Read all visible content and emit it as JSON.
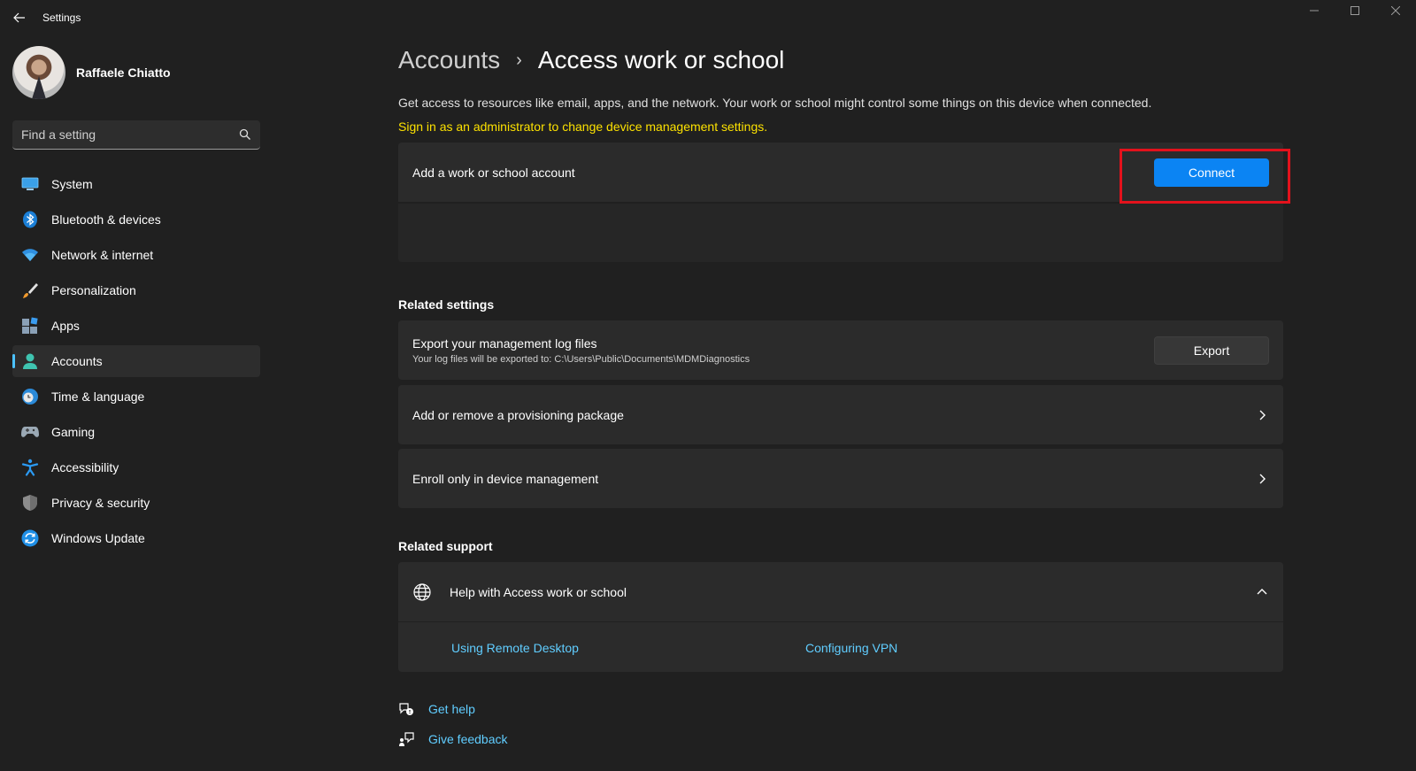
{
  "window": {
    "title": "Settings"
  },
  "profile": {
    "name": "Raffaele Chiatto"
  },
  "search": {
    "placeholder": "Find a setting"
  },
  "sidebar": {
    "items": [
      {
        "label": "System",
        "icon": "monitor-icon"
      },
      {
        "label": "Bluetooth & devices",
        "icon": "bluetooth-icon"
      },
      {
        "label": "Network & internet",
        "icon": "wifi-icon"
      },
      {
        "label": "Personalization",
        "icon": "brush-icon"
      },
      {
        "label": "Apps",
        "icon": "apps-icon"
      },
      {
        "label": "Accounts",
        "icon": "person-icon",
        "active": true
      },
      {
        "label": "Time & language",
        "icon": "globe-clock-icon"
      },
      {
        "label": "Gaming",
        "icon": "gamepad-icon"
      },
      {
        "label": "Accessibility",
        "icon": "accessibility-icon"
      },
      {
        "label": "Privacy & security",
        "icon": "shield-icon"
      },
      {
        "label": "Windows Update",
        "icon": "update-icon"
      }
    ]
  },
  "breadcrumb": {
    "parent": "Accounts",
    "separator": "›",
    "current": "Access work or school"
  },
  "main": {
    "description": "Get access to resources like email, apps, and the network. Your work or school might control some things on this device when connected.",
    "admin_notice": "Sign in as an administrator to change device management settings.",
    "add_account": {
      "title": "Add a work or school account",
      "button": "Connect"
    }
  },
  "related_settings": {
    "heading": "Related settings",
    "export": {
      "title": "Export your management log files",
      "subtitle": "Your log files will be exported to: C:\\Users\\Public\\Documents\\MDMDiagnostics",
      "button": "Export"
    },
    "provisioning": {
      "title": "Add or remove a provisioning package"
    },
    "enroll": {
      "title": "Enroll only in device management"
    }
  },
  "related_support": {
    "heading": "Related support",
    "help": {
      "title": "Help with Access work or school",
      "links": [
        "Using Remote Desktop",
        "Configuring VPN"
      ]
    }
  },
  "footer": {
    "get_help": "Get help",
    "give_feedback": "Give feedback"
  },
  "colors": {
    "background": "#202020",
    "card": "#2b2b2b",
    "accent": "#0b84f3",
    "link": "#60cdff",
    "warning": "#fce100",
    "highlight": "#e3121c"
  }
}
